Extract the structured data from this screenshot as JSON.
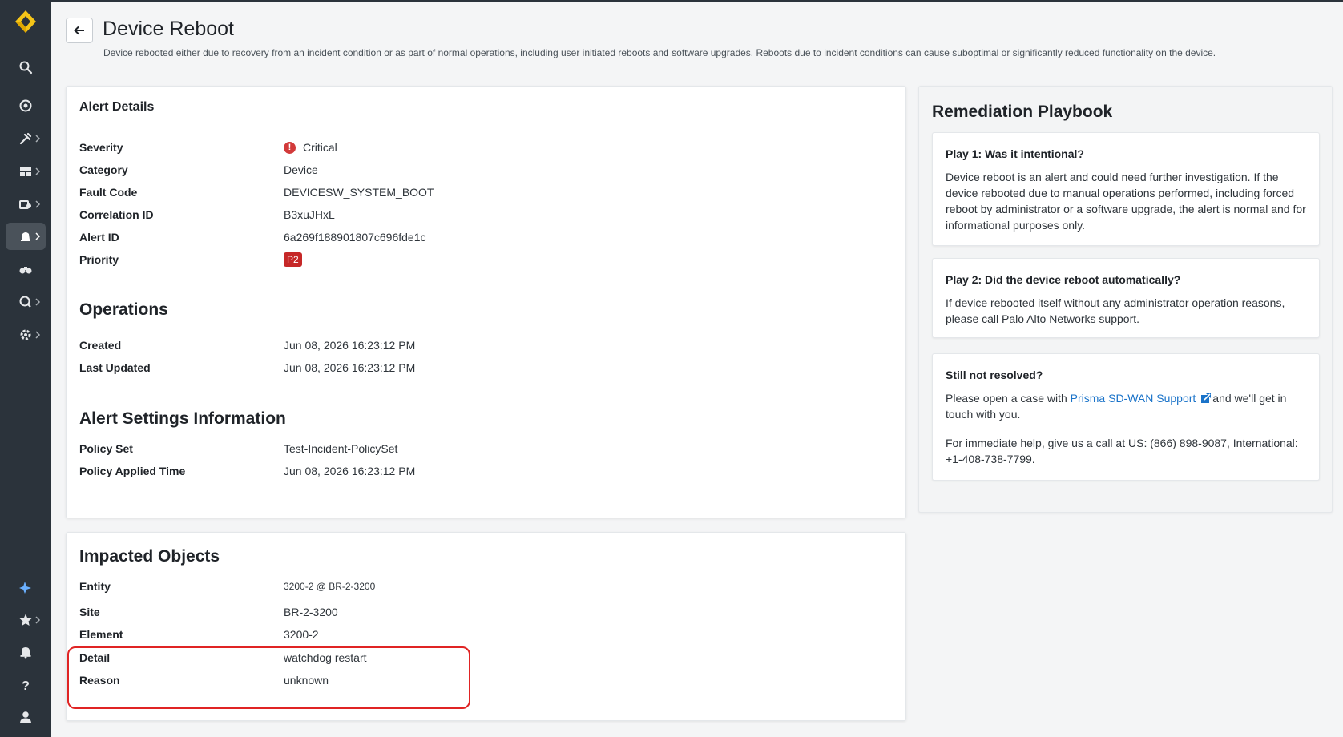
{
  "header": {
    "title": "Device Reboot",
    "description": "Device rebooted either due to recovery from an incident condition or as part of normal operations, including user initiated reboots and software upgrades. Reboots due to incident conditions can cause suboptimal or significantly reduced functionality on the device."
  },
  "sidebar": {
    "items": [
      {
        "icon": "search-icon"
      },
      {
        "icon": "radar-icon"
      },
      {
        "icon": "tools-icon"
      },
      {
        "icon": "dashboard-icon"
      },
      {
        "icon": "devices-icon"
      },
      {
        "icon": "alerts-icon",
        "active": true
      },
      {
        "icon": "binoculars-icon"
      },
      {
        "icon": "security-icon"
      },
      {
        "icon": "settings-icon"
      },
      {
        "icon": "ai-sparkle-icon"
      },
      {
        "icon": "star-icon"
      },
      {
        "icon": "bell-icon"
      },
      {
        "icon": "help-icon"
      },
      {
        "icon": "user-icon"
      }
    ]
  },
  "alert_details": {
    "title": "Alert Details",
    "severity": {
      "label": "Severity",
      "value": "Critical"
    },
    "category": {
      "label": "Category",
      "value": "Device"
    },
    "fault_code": {
      "label": "Fault Code",
      "value": "DEVICESW_SYSTEM_BOOT"
    },
    "correlation_id": {
      "label": "Correlation ID",
      "value": "B3xuJHxL"
    },
    "alert_id": {
      "label": "Alert ID",
      "value": "6a269f188901807c696fde1c"
    },
    "priority": {
      "label": "Priority",
      "value": "P2"
    }
  },
  "operations": {
    "title": "Operations",
    "created": {
      "label": "Created",
      "value": "Jun 08, 2026 16:23:12 PM"
    },
    "last_updated": {
      "label": "Last Updated",
      "value": "Jun 08, 2026 16:23:12 PM"
    }
  },
  "alert_settings": {
    "title": "Alert Settings Information",
    "policy_set": {
      "label": "Policy Set",
      "value": "Test-Incident-PolicySet"
    },
    "policy_applied_time": {
      "label": "Policy Applied Time",
      "value": "Jun 08, 2026 16:23:12 PM"
    }
  },
  "impacted_objects": {
    "title": "Impacted Objects",
    "entity": {
      "label": "Entity",
      "value": "3200-2 @ BR-2-3200"
    },
    "site": {
      "label": "Site",
      "value": "BR-2-3200"
    },
    "element": {
      "label": "Element",
      "value": "3200-2"
    },
    "detail": {
      "label": "Detail",
      "value": "watchdog restart"
    },
    "reason": {
      "label": "Reason",
      "value": "unknown"
    }
  },
  "playbook": {
    "title": "Remediation Playbook",
    "play1": {
      "title": "Play 1: Was it intentional?",
      "text": "Device reboot is an alert and could need further investigation. If the device rebooted due to manual operations performed, including forced reboot by administrator or a software upgrade, the alert is normal and for informational purposes only."
    },
    "play2": {
      "title": "Play 2: Did the device reboot automatically?",
      "text": "If device rebooted itself without any administrator operation reasons, please call Palo Alto Networks support."
    },
    "still": {
      "title": "Still not resolved?",
      "text_before": "Please open a case with ",
      "link": "Prisma SD-WAN Support",
      "text_after": "and we'll get in touch with you.",
      "phone_text": "For immediate help, give us a call at US: (866) 898-9087, International: +1-408-738-7799."
    }
  },
  "colors": {
    "sidebar": "#2b333b",
    "link": "#1a73c9",
    "critical": "#d23a3a",
    "priority_badge": "#c62828",
    "highlight": "#e02424"
  }
}
